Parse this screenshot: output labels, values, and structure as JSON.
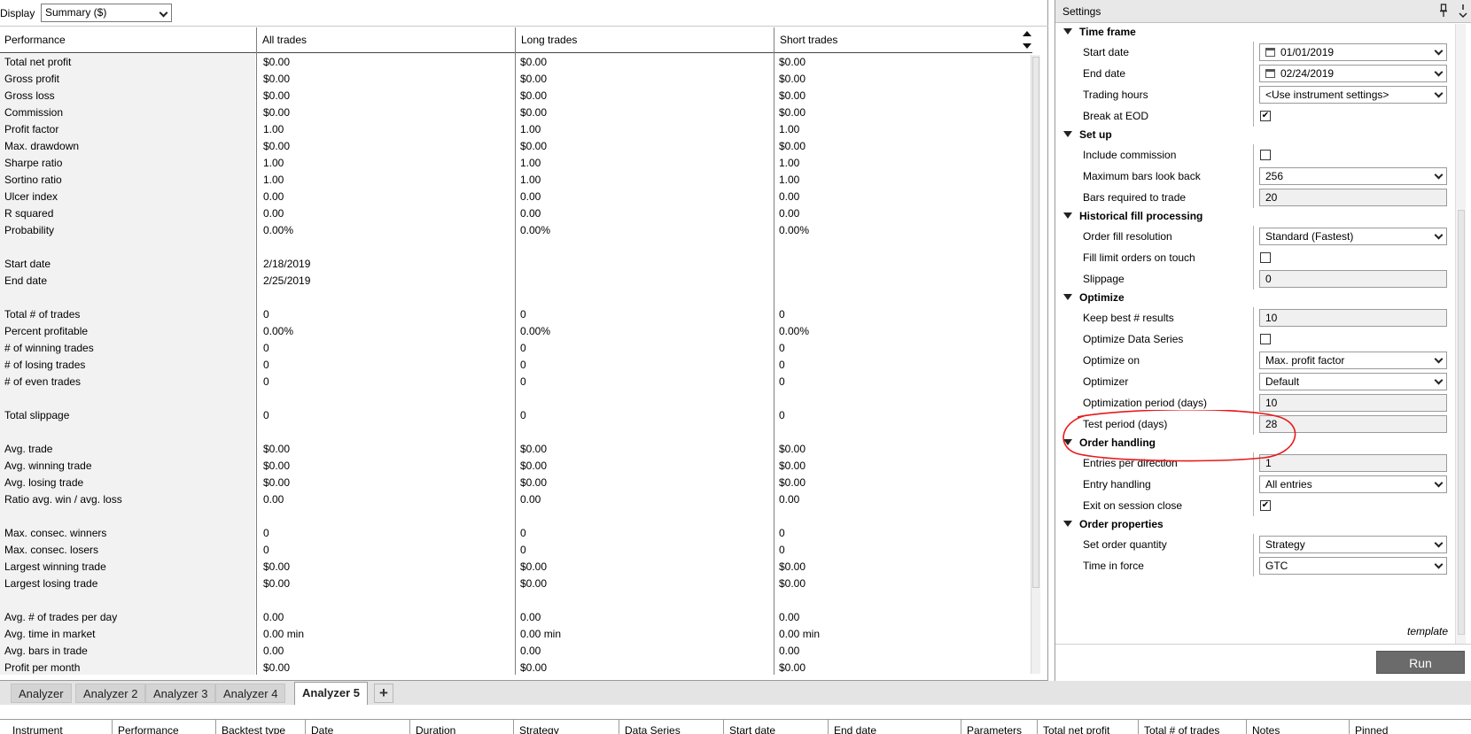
{
  "display": {
    "label": "Display",
    "selected": "Summary ($)"
  },
  "performance": {
    "columns": [
      "Performance",
      "All trades",
      "Long trades",
      "Short trades"
    ],
    "rows": [
      [
        "Total net profit",
        "$0.00",
        "$0.00",
        "$0.00"
      ],
      [
        "Gross profit",
        "$0.00",
        "$0.00",
        "$0.00"
      ],
      [
        "Gross loss",
        "$0.00",
        "$0.00",
        "$0.00"
      ],
      [
        "Commission",
        "$0.00",
        "$0.00",
        "$0.00"
      ],
      [
        "Profit factor",
        "1.00",
        "1.00",
        "1.00"
      ],
      [
        "Max. drawdown",
        "$0.00",
        "$0.00",
        "$0.00"
      ],
      [
        "Sharpe ratio",
        "1.00",
        "1.00",
        "1.00"
      ],
      [
        "Sortino ratio",
        "1.00",
        "1.00",
        "1.00"
      ],
      [
        "Ulcer index",
        "0.00",
        "0.00",
        "0.00"
      ],
      [
        "R squared",
        "0.00",
        "0.00",
        "0.00"
      ],
      [
        "Probability",
        "0.00%",
        "0.00%",
        "0.00%"
      ],
      [
        "",
        "",
        "",
        ""
      ],
      [
        "Start date",
        "2/18/2019",
        "",
        ""
      ],
      [
        "End date",
        "2/25/2019",
        "",
        ""
      ],
      [
        "",
        "",
        "",
        ""
      ],
      [
        "Total # of trades",
        "0",
        "0",
        "0"
      ],
      [
        "Percent profitable",
        "0.00%",
        "0.00%",
        "0.00%"
      ],
      [
        "# of winning trades",
        "0",
        "0",
        "0"
      ],
      [
        "# of losing trades",
        "0",
        "0",
        "0"
      ],
      [
        "# of even trades",
        "0",
        "0",
        "0"
      ],
      [
        "",
        "",
        "",
        ""
      ],
      [
        "Total slippage",
        "0",
        "0",
        "0"
      ],
      [
        "",
        "",
        "",
        ""
      ],
      [
        "Avg. trade",
        "$0.00",
        "$0.00",
        "$0.00"
      ],
      [
        "Avg. winning trade",
        "$0.00",
        "$0.00",
        "$0.00"
      ],
      [
        "Avg. losing trade",
        "$0.00",
        "$0.00",
        "$0.00"
      ],
      [
        "Ratio avg. win / avg. loss",
        "0.00",
        "0.00",
        "0.00"
      ],
      [
        "",
        "",
        "",
        ""
      ],
      [
        "Max. consec. winners",
        "0",
        "0",
        "0"
      ],
      [
        "Max. consec. losers",
        "0",
        "0",
        "0"
      ],
      [
        "Largest winning trade",
        "$0.00",
        "$0.00",
        "$0.00"
      ],
      [
        "Largest losing trade",
        "$0.00",
        "$0.00",
        "$0.00"
      ],
      [
        "",
        "",
        "",
        ""
      ],
      [
        "Avg. # of trades per day",
        "0.00",
        "0.00",
        "0.00"
      ],
      [
        "Avg. time in market",
        "0.00 min",
        "0.00 min",
        "0.00 min"
      ],
      [
        "Avg. bars in trade",
        "0.00",
        "0.00",
        "0.00"
      ],
      [
        "Profit per month",
        "$0.00",
        "$0.00",
        "$0.00"
      ]
    ]
  },
  "tabs": [
    {
      "label": "Analyzer",
      "active": false
    },
    {
      "label": "Analyzer 2",
      "active": false
    },
    {
      "label": "Analyzer 3",
      "active": false
    },
    {
      "label": "Analyzer 4",
      "active": false
    },
    {
      "label": "Analyzer 5",
      "active": true
    }
  ],
  "tab_add_label": "+",
  "results_grid": {
    "columns": [
      "Instrument",
      "Performance",
      "Backtest type",
      "Date",
      "Duration",
      "Strategy",
      "Data Series",
      "Start date",
      "End date",
      "Parameters",
      "Total net profit",
      "Total # of trades",
      "Notes",
      "Pinned"
    ]
  },
  "settings": {
    "title": "Settings",
    "sections": [
      {
        "title": "Time frame",
        "props": [
          {
            "name": "Start date",
            "kind": "date",
            "value": "01/01/2019"
          },
          {
            "name": "End date",
            "kind": "date",
            "value": "02/24/2019"
          },
          {
            "name": "Trading hours",
            "kind": "select",
            "value": "<Use instrument settings>"
          },
          {
            "name": "Break at EOD",
            "kind": "check",
            "checked": true
          }
        ]
      },
      {
        "title": "Set up",
        "props": [
          {
            "name": "Include commission",
            "kind": "check",
            "checked": false
          },
          {
            "name": "Maximum bars look back",
            "kind": "select",
            "value": "256"
          },
          {
            "name": "Bars required to trade",
            "kind": "text",
            "value": "20"
          }
        ]
      },
      {
        "title": "Historical fill processing",
        "props": [
          {
            "name": "Order fill resolution",
            "kind": "select",
            "value": "Standard (Fastest)"
          },
          {
            "name": "Fill limit orders on touch",
            "kind": "check",
            "checked": false
          },
          {
            "name": "Slippage",
            "kind": "text",
            "value": "0"
          }
        ]
      },
      {
        "title": "Optimize",
        "props": [
          {
            "name": "Keep best # results",
            "kind": "text",
            "value": "10"
          },
          {
            "name": "Optimize Data Series",
            "kind": "check",
            "checked": false
          },
          {
            "name": "Optimize on",
            "kind": "select",
            "value": "Max. profit factor"
          },
          {
            "name": "Optimizer",
            "kind": "select",
            "value": "Default"
          },
          {
            "name": "Optimization period (days)",
            "kind": "text",
            "value": "10"
          },
          {
            "name": "Test period (days)",
            "kind": "text",
            "value": "28"
          }
        ]
      },
      {
        "title": "Order handling",
        "props": [
          {
            "name": "Entries per direction",
            "kind": "text",
            "value": "1"
          },
          {
            "name": "Entry handling",
            "kind": "select",
            "value": "All entries"
          },
          {
            "name": "Exit on session close",
            "kind": "check",
            "checked": true
          }
        ]
      },
      {
        "title": "Order properties",
        "props": [
          {
            "name": "Set order quantity",
            "kind": "select",
            "value": "Strategy"
          },
          {
            "name": "Time in force",
            "kind": "select",
            "value": "GTC"
          }
        ]
      }
    ],
    "template_label": "template",
    "run_label": "Run"
  },
  "colors": {
    "highlight": "#e8191c",
    "run_button": "#6b6b6b",
    "label_column_bg": "#f2f2f2"
  },
  "icons": [
    "calendar-icon",
    "chevron-down-icon",
    "pin-icon",
    "checkmark-icon",
    "sort-arrow-icon",
    "expand-triangle-icon",
    "add-tab-icon"
  ]
}
